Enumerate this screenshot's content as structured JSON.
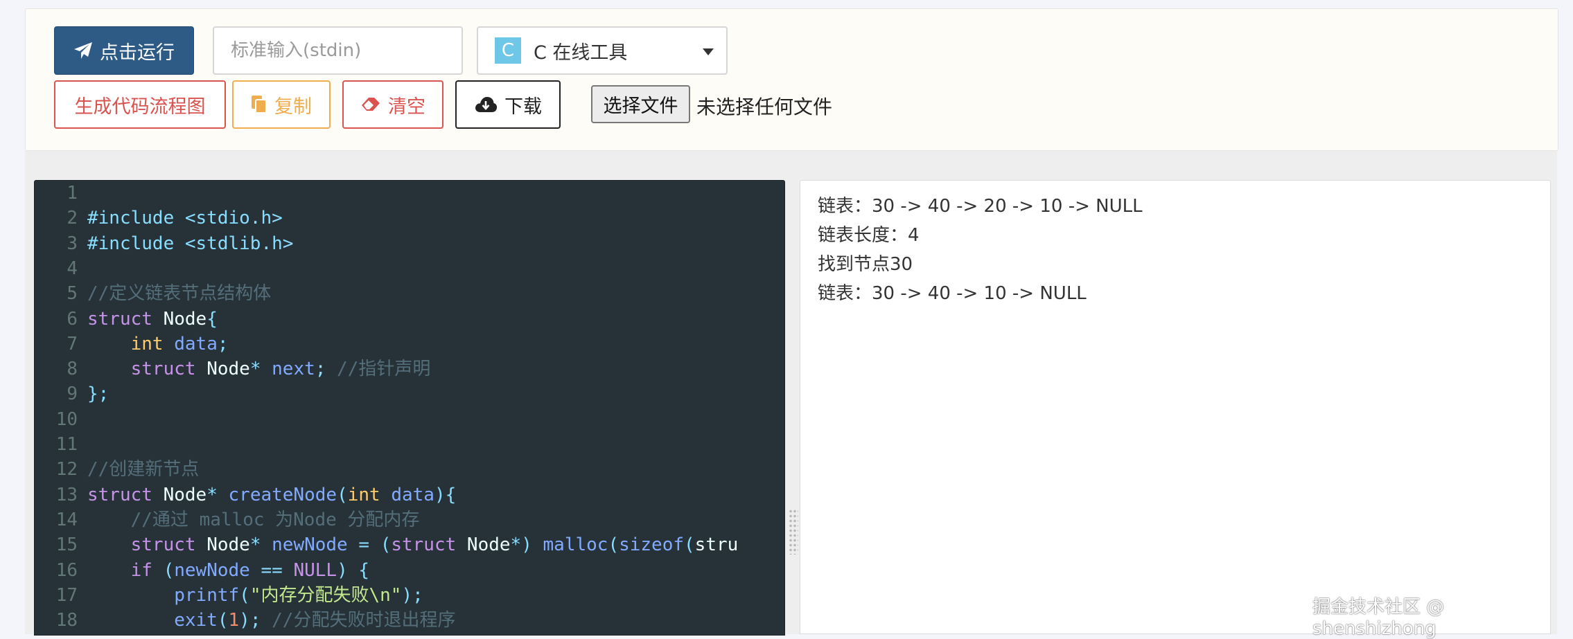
{
  "toolbar": {
    "run_label": "点击运行",
    "stdin_placeholder": "标准输入(stdin)",
    "language": {
      "icon_text": "C",
      "label": "C 在线工具"
    },
    "gen_flowchart_label": "生成代码流程图",
    "copy_label": "复制",
    "clear_label": "清空",
    "download_label": "下载",
    "file_button_label": "选择文件",
    "file_status": "未选择任何文件"
  },
  "icons": [
    "paper-plane-icon",
    "copy-icon",
    "eraser-icon",
    "cloud-download-icon",
    "chevron-down-icon"
  ],
  "colors": {
    "run_bg": "#2e5a86",
    "danger": "#d9534f",
    "warning": "#f0ad4e",
    "editor_bg": "#263238",
    "lang_icon_bg": "#6fc7e8"
  },
  "editor": {
    "lines": [
      {
        "n": "1",
        "t": ""
      },
      {
        "n": "2",
        "t": "#include <stdio.h>"
      },
      {
        "n": "3",
        "t": "#include <stdlib.h>"
      },
      {
        "n": "4",
        "t": ""
      },
      {
        "n": "5",
        "t": "//定义链表节点结构体"
      },
      {
        "n": "6",
        "t": "struct Node{"
      },
      {
        "n": "7",
        "t": "    int data;"
      },
      {
        "n": "8",
        "t": "    struct Node* next; //指针声明"
      },
      {
        "n": "9",
        "t": "};"
      },
      {
        "n": "10",
        "t": ""
      },
      {
        "n": "11",
        "t": ""
      },
      {
        "n": "12",
        "t": "//创建新节点"
      },
      {
        "n": "13",
        "t": "struct Node* createNode(int data){"
      },
      {
        "n": "14",
        "t": "    //通过 malloc 为Node 分配内存"
      },
      {
        "n": "15",
        "t": "    struct Node* newNode = (struct Node*) malloc(sizeof(stru"
      },
      {
        "n": "16",
        "t": "    if (newNode == NULL) {"
      },
      {
        "n": "17",
        "t": "        printf(\"内存分配失败\\n\");"
      },
      {
        "n": "18",
        "t": "        exit(1); //分配失败时退出程序"
      }
    ]
  },
  "output": {
    "lines": [
      "链表：30 -> 40 -> 20 -> 10 -> NULL",
      "链表长度：4",
      "找到节点30",
      "链表：30 -> 40 -> 10 -> NULL"
    ]
  },
  "watermark": "掘金技术社区 @ shenshizhong"
}
